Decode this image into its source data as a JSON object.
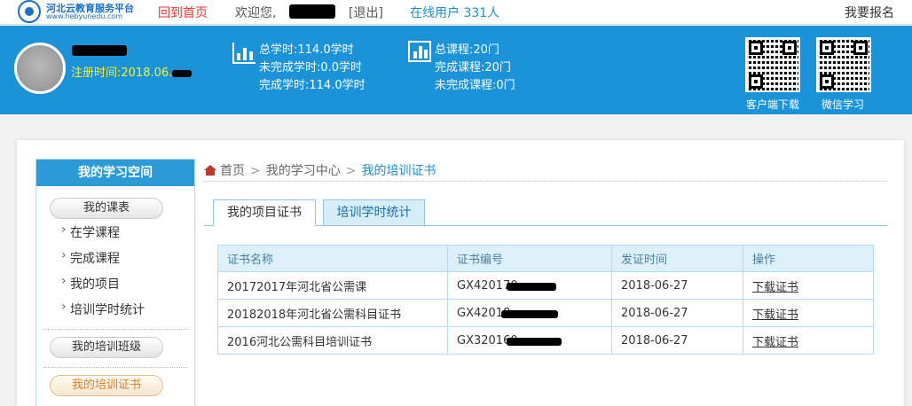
{
  "topbar": {
    "logo_title": "河北云教育服务平台",
    "logo_url": "www.hebyunedu.com",
    "home_link": "回到首页",
    "welcome": "欢迎您,",
    "logout": "[退出]",
    "online_label": "在线用户",
    "online_count": "331人",
    "report": "我要报名"
  },
  "banner": {
    "reg_time": "注册时间:2018.06.",
    "hours": {
      "total": "总学时:114.0学时",
      "incomplete": "未完成学时:0.0学时",
      "complete": "完成学时:114.0学时"
    },
    "courses": {
      "total": "总课程:20门",
      "complete": "完成课程:20门",
      "incomplete": "未完成课程:0门"
    },
    "qr1_label": "客户端下载",
    "qr2_label": "微信学习"
  },
  "sidebar": {
    "title": "我的学习空间",
    "schedule": "我的课表",
    "items": [
      "在学课程",
      "完成课程",
      "我的项目",
      "培训学时统计"
    ],
    "my_class": "我的培训班级",
    "my_cert": "我的培训证书"
  },
  "breadcrumb": {
    "home": "首页",
    "center": "我的学习中心",
    "current": "我的培训证书"
  },
  "tabs": [
    "我的项目证书",
    "培训学时统计"
  ],
  "table": {
    "headers": [
      "证书名称",
      "证书编号",
      "发证时间",
      "操作"
    ],
    "rows": [
      {
        "name": "20172017年河北省公需课",
        "code": "GX420170",
        "date": "2018-06-27",
        "action": "下载证书"
      },
      {
        "name": "20182018年河北省公需科目证书",
        "code": "GX42018",
        "date": "2018-06-27",
        "action": "下载证书"
      },
      {
        "name": "2016河北公需科目培训证书",
        "code": "GX320160",
        "date": "2018-06-27",
        "action": "下载证书"
      }
    ]
  },
  "colors": {
    "banner_blue": "#1b93d9",
    "accent_red": "#e33333",
    "reg_yellow": "#f7f032",
    "active_orange": "#e67e22"
  }
}
